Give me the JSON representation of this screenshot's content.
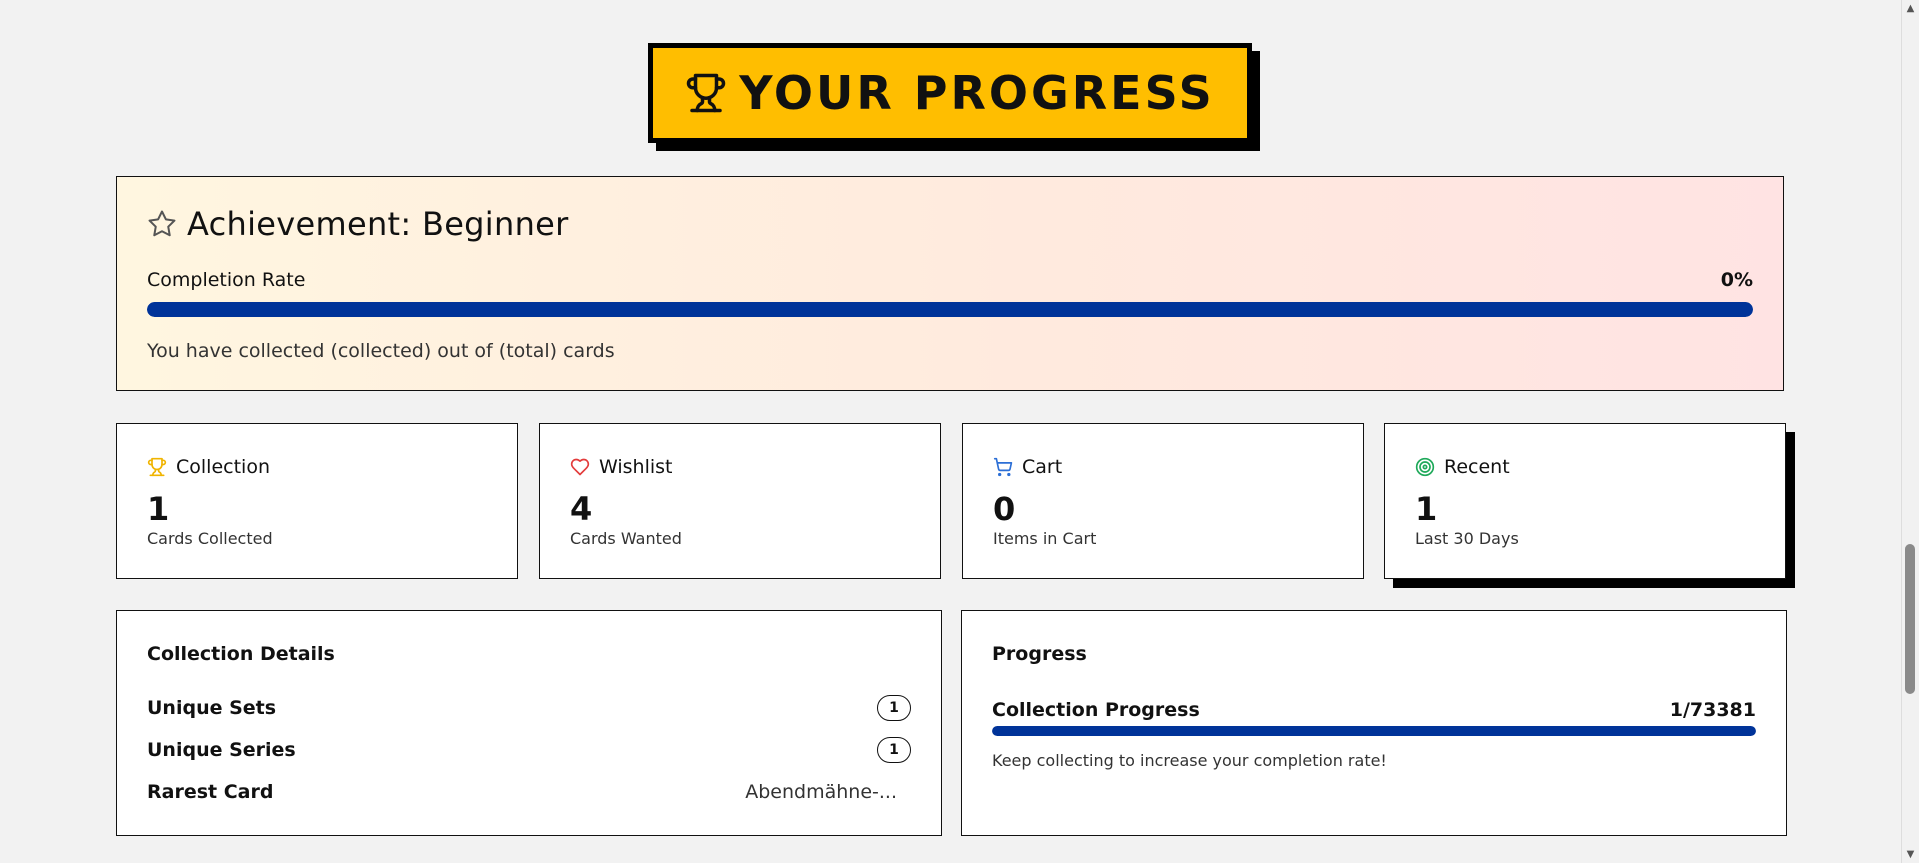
{
  "header": {
    "title": "YOUR PROGRESS",
    "icon": "trophy-icon"
  },
  "achievement": {
    "icon": "star-icon",
    "title": "Achievement: Beginner",
    "completion_label": "Completion Rate",
    "completion_value": "0%",
    "completion_fill": 1.0,
    "description": "You have collected (collected) out of (total) cards"
  },
  "stats": [
    {
      "icon": "trophy-icon",
      "icon_color": "#f0b400",
      "label": "Collection",
      "value": "1",
      "sub": "Cards Collected"
    },
    {
      "icon": "heart-icon",
      "icon_color": "#e33b3b",
      "label": "Wishlist",
      "value": "4",
      "sub": "Cards Wanted"
    },
    {
      "icon": "cart-icon",
      "icon_color": "#2c6fd6",
      "label": "Cart",
      "value": "0",
      "sub": "Items in Cart"
    },
    {
      "icon": "target-icon",
      "icon_color": "#1fa95a",
      "label": "Recent",
      "value": "1",
      "sub": "Last 30 Days"
    }
  ],
  "details": {
    "title": "Collection Details",
    "rows": [
      {
        "label": "Unique Sets",
        "value": "1"
      },
      {
        "label": "Unique Series",
        "value": "1"
      },
      {
        "label": "Rarest Card",
        "value": "Abendmähne-..."
      }
    ]
  },
  "progress": {
    "title": "Progress",
    "label": "Collection Progress",
    "value": "1/73381",
    "fill": 1.0,
    "note": "Keep collecting to increase your completion rate!"
  },
  "colors": {
    "banner": "#ffbe00",
    "bar": "#003399",
    "background": "#f2f2f2"
  }
}
